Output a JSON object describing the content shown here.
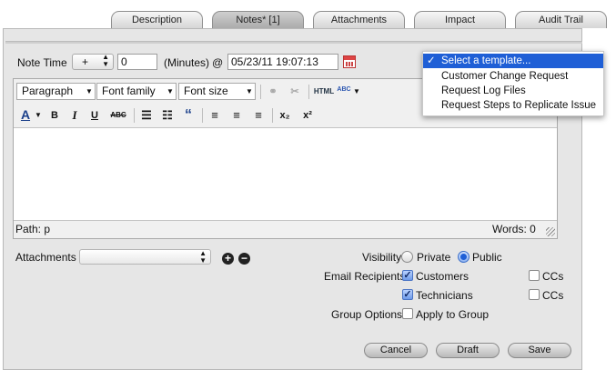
{
  "tabs": [
    {
      "label": "Description"
    },
    {
      "label": "Notes* [1]"
    },
    {
      "label": "Attachments"
    },
    {
      "label": "Impact"
    },
    {
      "label": "Audit Trail"
    }
  ],
  "note_time": {
    "label": "Note Time",
    "sign": "+",
    "minutes_value": "0",
    "minutes_label": "(Minutes)",
    "at": "@",
    "datetime_value": "05/23/11 19:07:13"
  },
  "template_menu": {
    "items": [
      {
        "label": "Select a template...",
        "selected": true
      },
      {
        "label": "Customer Change Request",
        "selected": false
      },
      {
        "label": "Request Log Files",
        "selected": false
      },
      {
        "label": "Request Steps to Replicate Issue",
        "selected": false
      }
    ],
    "check": "✓"
  },
  "editor": {
    "format_select": "Paragraph",
    "font_family_select": "Font family",
    "font_size_select": "Font size",
    "html_button": "HTML",
    "spell_label": "ABC",
    "path": "Path: p",
    "words": "Words: 0",
    "toolbar_glyphs": {
      "bold": "B",
      "italic": "I",
      "underline": "U",
      "strike": "ABC",
      "blockquote": "“",
      "subscript": "x₂",
      "superscript": "x²",
      "font_color": "A"
    }
  },
  "form": {
    "attachments_label": "Attachments",
    "add_symbol": "+",
    "remove_symbol": "−",
    "visibility_label": "Visibility",
    "visibility_options": [
      {
        "label": "Private",
        "selected": false
      },
      {
        "label": "Public",
        "selected": true
      }
    ],
    "email_recipients_label": "Email Recipients",
    "customers_label": "Customers",
    "customers_checked": true,
    "customers_cc_label": "CCs",
    "technicians_label": "Technicians",
    "technicians_checked": true,
    "technicians_cc_label": "CCs",
    "group_options_label": "Group Options",
    "apply_to_group_label": "Apply to Group"
  },
  "buttons": {
    "cancel": "Cancel",
    "draft": "Draft",
    "save": "Save"
  },
  "colors": {
    "accent": "#1f5fd6",
    "panel": "#e6e6e6"
  }
}
